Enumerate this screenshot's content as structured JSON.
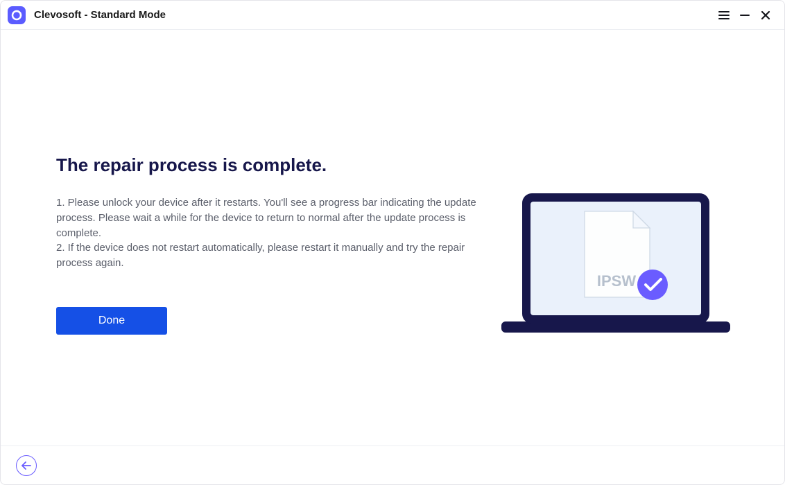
{
  "titlebar": {
    "app_title": "Clevosoft - Standard Mode"
  },
  "main": {
    "heading": "The repair process is complete.",
    "instruction1": "1. Please unlock your device after it restarts. You'll see a progress bar indicating the update process. Please wait a while for the device to return to normal after the update process is complete.",
    "instruction2": "2. If the device does not restart automatically, please restart it manually and try the repair process again.",
    "done_label": "Done",
    "file_label": "IPSW"
  }
}
